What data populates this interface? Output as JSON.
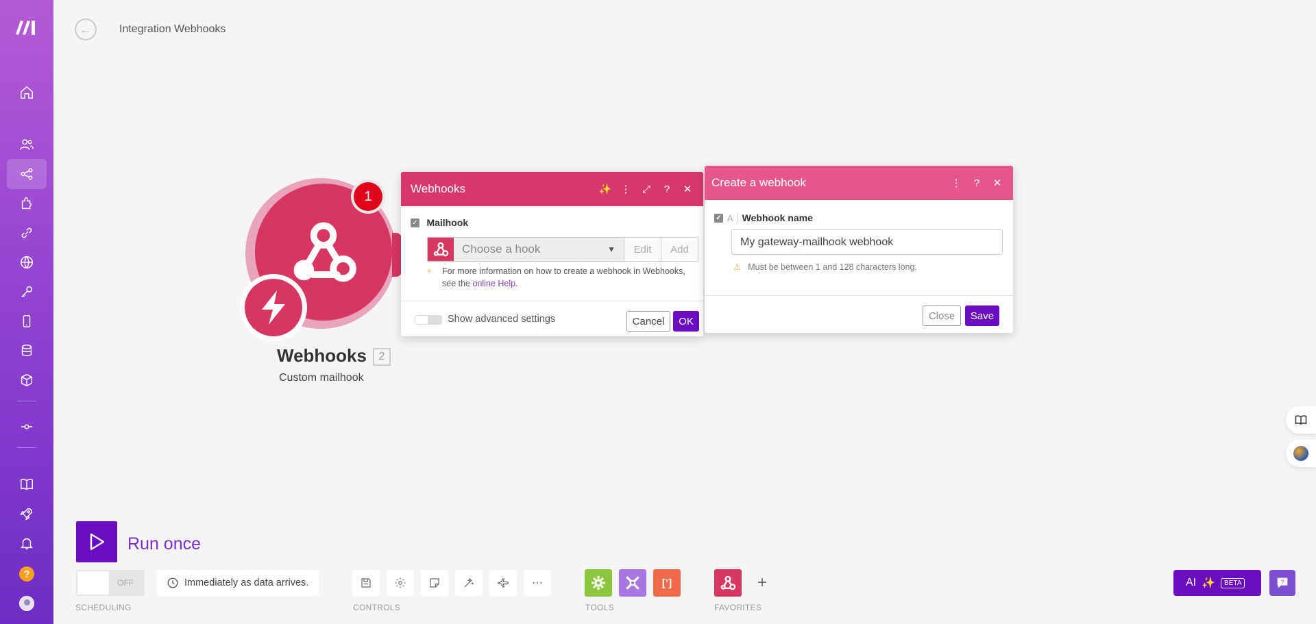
{
  "header": {
    "title": "Integration Webhooks"
  },
  "module": {
    "name": "Webhooks",
    "id_badge": "2",
    "subtitle": "Custom mailhook",
    "counter": "1",
    "color": "#d6365f"
  },
  "webhooks_panel": {
    "title": "Webhooks",
    "field_label": "Mailhook",
    "select_placeholder": "Choose a hook",
    "edit_label": "Edit",
    "add_label": "Add",
    "hint_text": "For more information on how to create a webhook in Webhooks, see the",
    "hint_link": "online Help",
    "hint_end": ".",
    "advanced_label": "Show advanced settings",
    "cancel_label": "Cancel",
    "ok_label": "OK"
  },
  "create_panel": {
    "title": "Create a webhook",
    "field_label": "Webhook name",
    "field_type": "A",
    "field_value": "My gateway-mailhook webhook",
    "warning": "Must be between 1 and 128 characters long.",
    "close_label": "Close",
    "save_label": "Save"
  },
  "bottom": {
    "run_label": "Run once",
    "toggle_state": "OFF",
    "schedule_text": "Immediately as data arrives.",
    "scheduling_label": "SCHEDULING",
    "controls_label": "CONTROLS",
    "tools_label": "TOOLS",
    "favorites_label": "FAVORITES",
    "ai_label": "AI",
    "beta_label": "BETA"
  },
  "sidebar": {
    "items": [
      "home-icon",
      "team-icon",
      "scenarios-icon",
      "apps-icon",
      "connections-icon",
      "webhooks-icon",
      "keys-icon",
      "devices-icon",
      "datastores-icon",
      "datastructures-icon",
      "flow-icon",
      "docs-icon",
      "launch-icon",
      "notifications-icon"
    ]
  },
  "colors": {
    "brand": "#6a0dc0",
    "panel_header": "#d7386b",
    "tool_green": "#8cc63f",
    "tool_purple": "#a776e0",
    "tool_orange": "#f26a4b"
  }
}
